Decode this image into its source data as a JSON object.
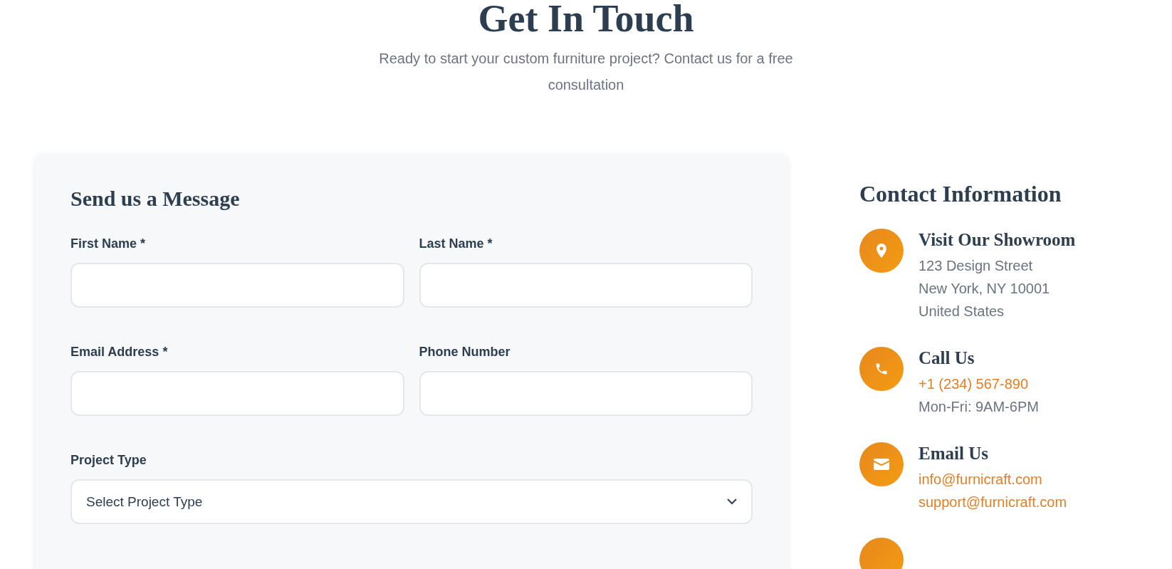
{
  "header": {
    "title": "Get In Touch",
    "subtitle": "Ready to start your custom furniture project? Contact us for a free consultation"
  },
  "form": {
    "title": "Send us a Message",
    "rows": [
      [
        {
          "label": "First Name *",
          "kind": "text"
        },
        {
          "label": "Last Name *",
          "kind": "text"
        }
      ],
      [
        {
          "label": "Email Address *",
          "kind": "text"
        },
        {
          "label": "Phone Number",
          "kind": "text"
        }
      ],
      [
        {
          "label": "Project Type",
          "kind": "select",
          "placeholder": "Select Project Type"
        }
      ]
    ]
  },
  "contact": {
    "title": "Contact Information",
    "items": [
      {
        "kind": "pin",
        "title": "Visit Our Showroom",
        "lines": [
          {
            "text": "123 Design Street",
            "kind": "plain"
          },
          {
            "text": "New York, NY 10001",
            "kind": "plain"
          },
          {
            "text": "United States",
            "kind": "plain"
          }
        ]
      },
      {
        "kind": "phone",
        "title": "Call Us",
        "lines": [
          {
            "text": "+1 (234) 567-890",
            "kind": "link"
          },
          {
            "text": "Mon-Fri: 9AM-6PM",
            "kind": "plain"
          }
        ]
      },
      {
        "kind": "mail",
        "title": "Email Us",
        "lines": [
          {
            "text": "info@furnicraft.com",
            "kind": "link"
          },
          {
            "text": "support@furnicraft.com",
            "kind": "link"
          }
        ]
      },
      {
        "kind": "blank"
      }
    ]
  }
}
